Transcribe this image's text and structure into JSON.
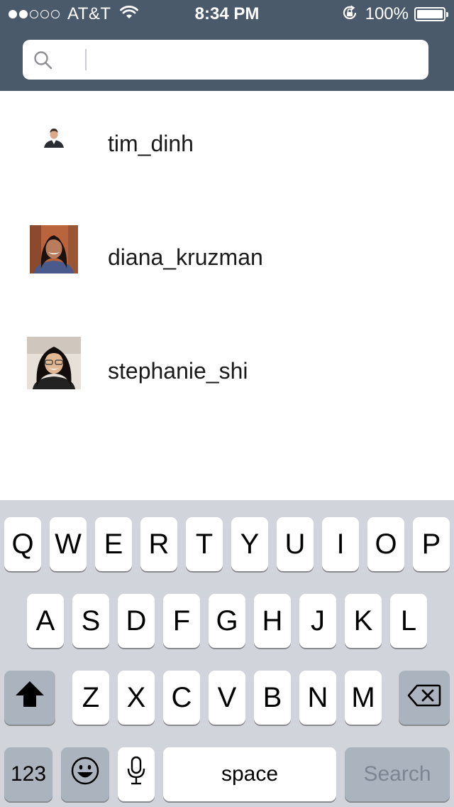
{
  "status_bar": {
    "signal_full": 2,
    "signal_empty": 3,
    "carrier": "AT&T",
    "time": "8:34 PM",
    "battery_percent": "100%",
    "battery_level": 1.0
  },
  "search": {
    "value": "",
    "placeholder": ""
  },
  "users": [
    {
      "username": "tim_dinh"
    },
    {
      "username": "diana_kruzman"
    },
    {
      "username": "stephanie_shi"
    }
  ],
  "keyboard": {
    "row1": [
      "Q",
      "W",
      "E",
      "R",
      "T",
      "Y",
      "U",
      "I",
      "O",
      "P"
    ],
    "row2": [
      "A",
      "S",
      "D",
      "F",
      "G",
      "H",
      "J",
      "K",
      "L"
    ],
    "row3": [
      "Z",
      "X",
      "C",
      "V",
      "B",
      "N",
      "M"
    ],
    "numbers_label": "123",
    "space_label": "space",
    "return_label": "Search"
  },
  "colors": {
    "header_bg": "#4b5a6b",
    "keyboard_bg": "#d1d5db",
    "key_bg": "#ffffff",
    "key_dark_bg": "#abb3be"
  }
}
